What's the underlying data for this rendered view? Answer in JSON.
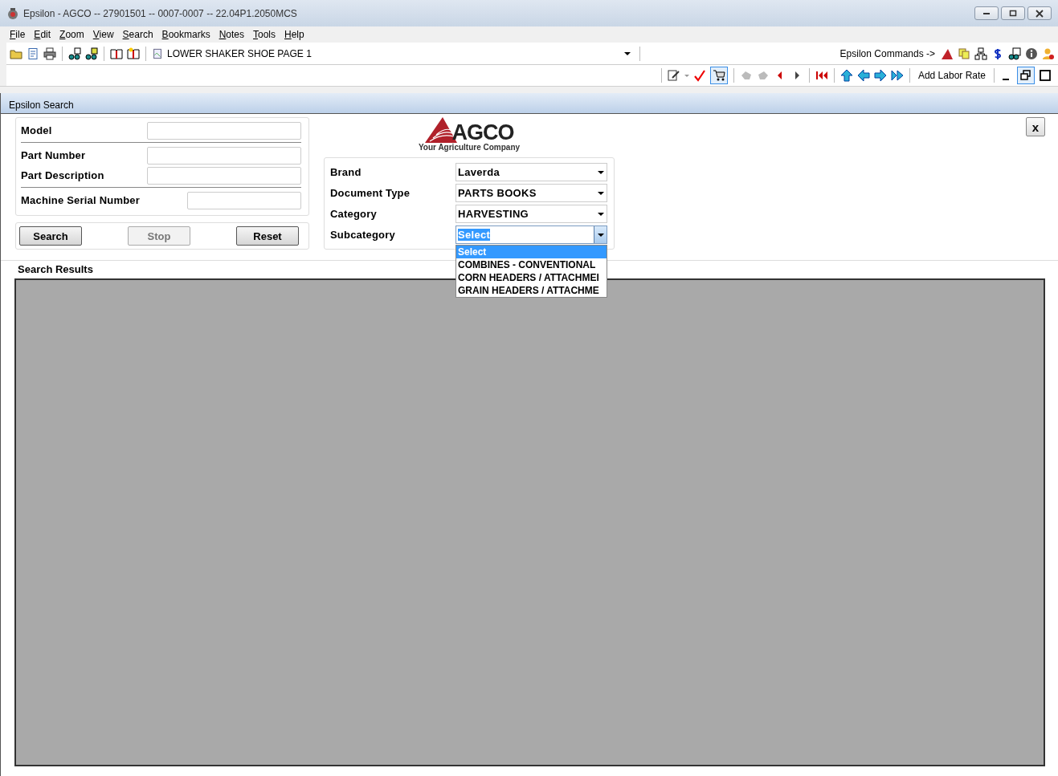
{
  "window": {
    "title": "Epsilon - AGCO -- 27901501 -- 0007-0007 -- 22.04P1.2050MCS"
  },
  "menu": [
    "File",
    "Edit",
    "Zoom",
    "View",
    "Search",
    "Bookmarks",
    "Notes",
    "Tools",
    "Help"
  ],
  "toolbar": {
    "document": "LOWER SHAKER SHOE PAGE 1",
    "commands_label": "Epsilon Commands ->",
    "labor_rate": "Add Labor Rate",
    "cart_pressed": true,
    "restore_pressed": true
  },
  "panel": {
    "title": "Epsilon Search",
    "close": "x"
  },
  "search_field_groups": [
    [
      {
        "label": "Model"
      }
    ],
    [
      {
        "label": "Part Number"
      },
      {
        "label": "Part Description"
      }
    ],
    [
      {
        "label": "Machine Serial Number"
      }
    ]
  ],
  "buttons": [
    {
      "label": "Search",
      "disabled": false
    },
    {
      "label": "Stop",
      "disabled": true
    },
    {
      "label": "Reset",
      "disabled": false
    }
  ],
  "logo": {
    "name": "AGCO",
    "tagline": "Your Agriculture Company"
  },
  "filters": [
    {
      "label": "Brand",
      "value": "Laverda",
      "focused": false
    },
    {
      "label": "Document Type",
      "value": "PARTS BOOKS",
      "focused": false
    },
    {
      "label": "Category",
      "value": "HARVESTING",
      "focused": false
    },
    {
      "label": "Subcategory",
      "value": "Select",
      "focused": true
    }
  ],
  "dropdown_options": [
    {
      "label": "Select",
      "selected": true
    },
    {
      "label": "COMBINES - CONVENTIONAL",
      "selected": false
    },
    {
      "label": "CORN HEADERS / ATTACHMEI",
      "selected": false
    },
    {
      "label": "GRAIN HEADERS / ATTACHME",
      "selected": false
    }
  ],
  "results": {
    "title": "Search Results"
  }
}
